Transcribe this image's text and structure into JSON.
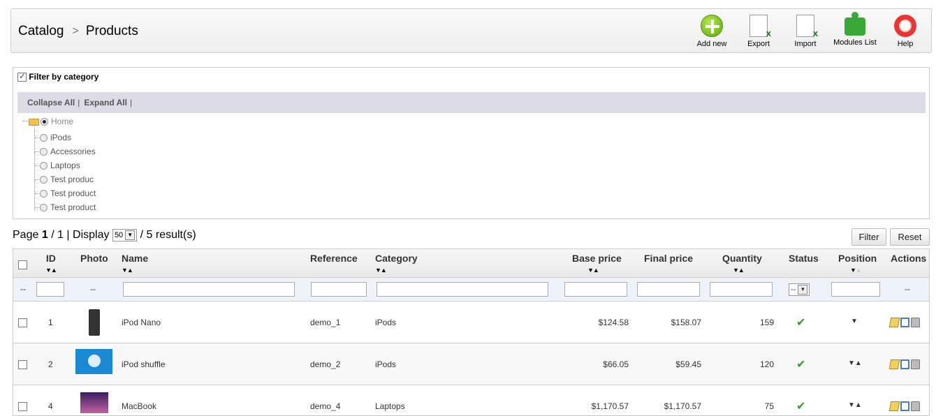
{
  "breadcrumb": {
    "section": "Catalog",
    "separator": ">",
    "page": "Products"
  },
  "toolbar": [
    {
      "label": "Add new",
      "icon": "add-icon"
    },
    {
      "label": "Export",
      "icon": "excel-export-icon"
    },
    {
      "label": "Import",
      "icon": "excel-import-icon"
    },
    {
      "label": "Modules List",
      "icon": "puzzle-icon"
    },
    {
      "label": "Help",
      "icon": "lifebuoy-icon"
    }
  ],
  "category_filter": {
    "label": "Filter by category",
    "checked": true,
    "collapse_all": "Collapse All",
    "expand_all": "Expand All",
    "separator": "|",
    "tree": [
      {
        "label": "Home",
        "selected": true
      },
      {
        "label": "iPods",
        "selected": false
      },
      {
        "label": "Accessories",
        "selected": false
      },
      {
        "label": "Laptops",
        "selected": false
      },
      {
        "label": "Test produc",
        "selected": false
      },
      {
        "label": "Test product",
        "selected": false
      },
      {
        "label": "Test product",
        "selected": false
      }
    ]
  },
  "pagination": {
    "page_label": "Page",
    "current": "1",
    "of": "/ 1 | Display",
    "per_page": "50",
    "results": "/ 5 result(s)"
  },
  "buttons": {
    "filter": "Filter",
    "reset": "Reset"
  },
  "table": {
    "columns": [
      "ID",
      "Photo",
      "Name",
      "Reference",
      "Category",
      "Base price",
      "Final price",
      "Quantity",
      "Status",
      "Position",
      "Actions"
    ],
    "filter_placeholder": "--",
    "status_filter_value": "--",
    "rows": [
      {
        "id": "1",
        "name": "iPod Nano",
        "reference": "demo_1",
        "category": "iPods",
        "base_price": "$124.58",
        "final_price": "$158.07",
        "quantity": "159",
        "status": "enabled",
        "position": "▼"
      },
      {
        "id": "2",
        "name": "iPod shuffle",
        "reference": "demo_2",
        "category": "iPods",
        "base_price": "$66.05",
        "final_price": "$59.45",
        "quantity": "120",
        "status": "enabled",
        "position": "▼▲"
      },
      {
        "id": "4",
        "name": "MacBook",
        "reference": "demo_4",
        "category": "Laptops",
        "base_price": "$1,170.57",
        "final_price": "$1,170.57",
        "quantity": "75",
        "status": "enabled",
        "position": "▼▲"
      }
    ]
  },
  "colors": {
    "accent_green": "#3a9a2a",
    "header_bg": "#dcdce6",
    "border": "#cccccc"
  }
}
